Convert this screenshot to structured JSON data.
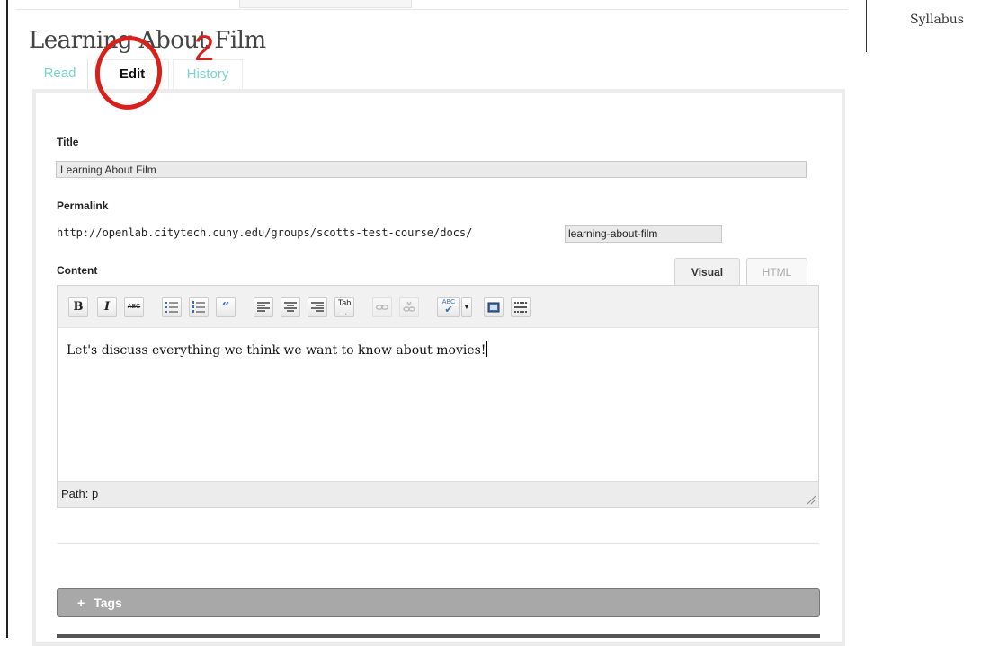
{
  "sidebar": {
    "syllabus_label": "Syllabus"
  },
  "page": {
    "title": "Learning About Film"
  },
  "tabs": [
    {
      "label": "Read"
    },
    {
      "label": "Edit"
    },
    {
      "label": "History"
    }
  ],
  "annotation": {
    "number": "2",
    "color": "#d9211c"
  },
  "form": {
    "title_label": "Title",
    "title_value": "Learning About Film",
    "permalink_label": "Permalink",
    "permalink_base": "http://openlab.citytech.cuny.edu/groups/scotts-test-course/docs/",
    "permalink_slug": "learning-about-film",
    "content_label": "Content"
  },
  "editor": {
    "tabs": {
      "visual": "Visual",
      "html": "HTML"
    },
    "toolbar": [
      "bold-icon",
      "italic-icon",
      "strikethrough-icon",
      "bullet-list-icon",
      "numbered-list-icon",
      "blockquote-icon",
      "align-left-icon",
      "align-center-icon",
      "align-right-icon",
      "tab-icon",
      "link-icon",
      "unlink-icon",
      "spellcheck-icon",
      "fullscreen-icon",
      "kitchen-sink-icon"
    ],
    "toolbar_text": {
      "bold": "B",
      "italic": "I",
      "strike": "ABC",
      "tab": "Tab",
      "spell": "ABC"
    },
    "body_text": "Let's discuss everything we think we want to know about movies!",
    "path_label": "Path: p"
  },
  "tags": {
    "plus": "+",
    "label": "Tags"
  },
  "colors": {
    "accent_teal": "#7bd3cd",
    "tags_bar": "#a8a8a8"
  }
}
